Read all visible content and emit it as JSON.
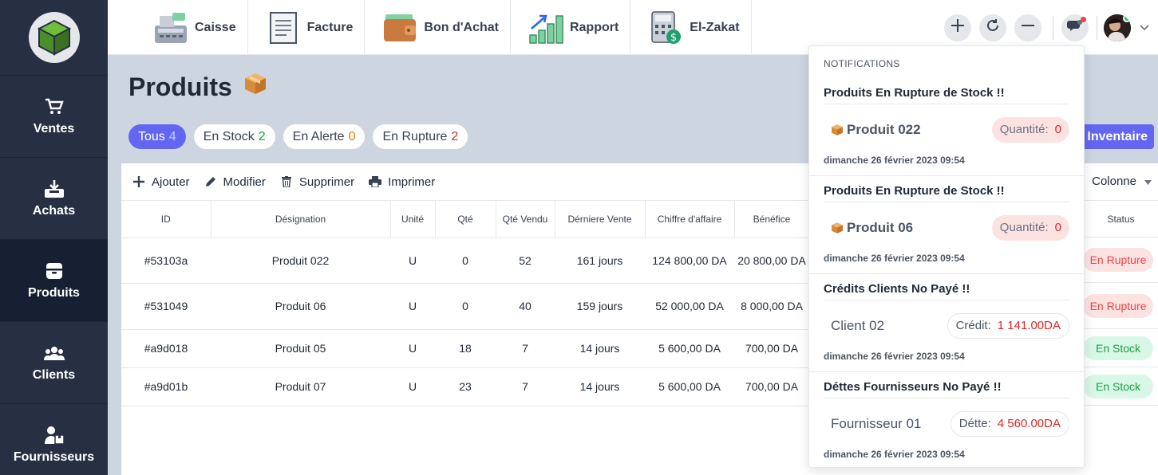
{
  "sidebar": {
    "items": [
      {
        "label": "Ventes",
        "icon": "cart-icon"
      },
      {
        "label": "Achats",
        "icon": "inbox-download-icon"
      },
      {
        "label": "Produits",
        "icon": "box-icon",
        "active": true
      },
      {
        "label": "Clients",
        "icon": "users-icon"
      },
      {
        "label": "Fournisseurs",
        "icon": "supplier-icon"
      }
    ]
  },
  "topbar": {
    "shortcuts": [
      {
        "label": "Caisse",
        "icon": "cash-register-icon"
      },
      {
        "label": "Facture",
        "icon": "invoice-icon"
      },
      {
        "label": "Bon d'Achat",
        "icon": "wallet-icon"
      },
      {
        "label": "Rapport",
        "icon": "report-chart-icon"
      },
      {
        "label": "El-Zakat",
        "icon": "calculator-money-icon"
      }
    ]
  },
  "page": {
    "title": "Produits"
  },
  "filters": [
    {
      "label": "Tous",
      "count": "4"
    },
    {
      "label": "En Stock",
      "count": "2"
    },
    {
      "label": "En Alerte",
      "count": "0"
    },
    {
      "label": "En Rupture",
      "count": "2"
    }
  ],
  "inventaire_label": "Inventaire",
  "toolbar": {
    "add": "Ajouter",
    "edit": "Modifier",
    "delete": "Supprimer",
    "print": "Imprimer",
    "columns": "Colonne"
  },
  "table": {
    "headers": [
      "ID",
      "Désignation",
      "Unité",
      "Qté",
      "Qté Vendu",
      "Dérniere Vente",
      "Chiffre d'affaire",
      "Bénéfice"
    ],
    "status_header": "Status",
    "rows": [
      {
        "id": "#53103a",
        "designation": "Produit 022",
        "unite": "U",
        "qte": "0",
        "vendu": "52",
        "derniere": "161 jours",
        "ca": "124 800,00 DA",
        "benefice": "20 800,00 DA",
        "status": "En Rupture"
      },
      {
        "id": "#531049",
        "designation": "Produit 06",
        "unite": "U",
        "qte": "0",
        "vendu": "40",
        "derniere": "159 jours",
        "ca": "52 000,00 DA",
        "benefice": "8 000,00 DA",
        "status": "En Rupture"
      },
      {
        "id": "#a9d018",
        "designation": "Produit 05",
        "unite": "U",
        "qte": "18",
        "vendu": "7",
        "derniere": "14 jours",
        "ca": "5 600,00 DA",
        "benefice": "700,00 DA",
        "status": "En Stock"
      },
      {
        "id": "#a9d01b",
        "designation": "Produit 07",
        "unite": "U",
        "qte": "23",
        "vendu": "7",
        "derniere": "14 jours",
        "ca": "5 600,00 DA",
        "benefice": "700,00 DA",
        "status": "En Stock"
      }
    ]
  },
  "notifications": {
    "heading": "NOTIFICATIONS",
    "items": [
      {
        "title": "Produits En Rupture de Stock !!",
        "name": "Produit 022",
        "badge_label": "Quantité:",
        "badge_value": "0",
        "date": "dimanche 26 février 2023 09:54"
      },
      {
        "title": "Produits En Rupture de Stock !!",
        "name": "Produit 06",
        "badge_label": "Quantité:",
        "badge_value": "0",
        "date": "dimanche 26 février 2023 09:54"
      },
      {
        "title": "Crédits Clients No Payé !!",
        "name": "Client 02",
        "badge_label": "Crédit:",
        "badge_value": "1 141.00DA",
        "date": "dimanche 26 février 2023 09:54"
      },
      {
        "title": "Déttes Fournisseurs No Payé !!",
        "name": "Fournisseur 01",
        "badge_label": "Détte:",
        "badge_value": "4 560.00DA",
        "date": "dimanche 26 février 2023 09:54"
      }
    ]
  },
  "colors": {
    "sidebar": "#263042",
    "accent": "#6366f1",
    "danger": "#dc2626",
    "success": "#16a34a"
  }
}
